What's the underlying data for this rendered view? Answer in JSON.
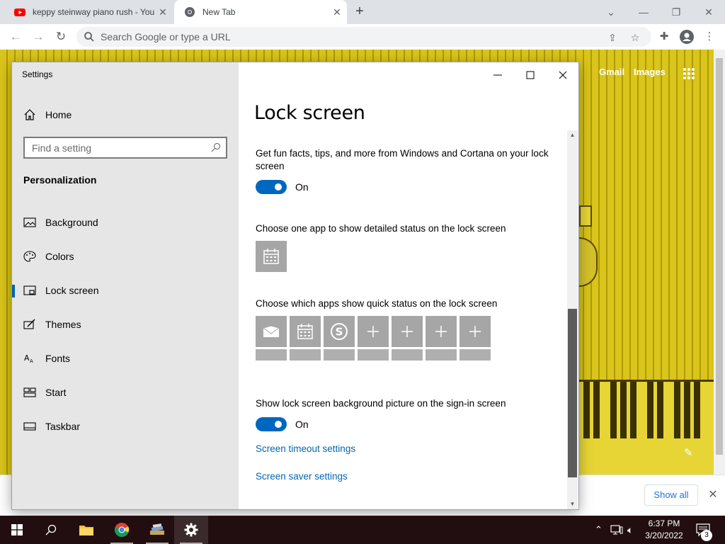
{
  "browser": {
    "tabs": [
      {
        "label": "keppy steinway piano rush - You",
        "icon": "youtube-icon"
      },
      {
        "label": "New Tab",
        "icon": "chrome-icon"
      }
    ],
    "omnibox_placeholder": "Search Google or type a URL"
  },
  "ntp": {
    "gmail": "Gmail",
    "images": "Images",
    "show_all": "Show all"
  },
  "settings": {
    "window_title": "Settings",
    "home": "Home",
    "search_placeholder": "Find a setting",
    "group": "Personalization",
    "nav": [
      {
        "label": "Background",
        "icon": "picture-icon"
      },
      {
        "label": "Colors",
        "icon": "palette-icon"
      },
      {
        "label": "Lock screen",
        "icon": "lock-screen-icon"
      },
      {
        "label": "Themes",
        "icon": "brush-icon"
      },
      {
        "label": "Fonts",
        "icon": "font-icon"
      },
      {
        "label": "Start",
        "icon": "start-icon"
      },
      {
        "label": "Taskbar",
        "icon": "taskbar-icon"
      }
    ],
    "page_title": "Lock screen",
    "fun_facts_text": "Get fun facts, tips, and more from Windows and Cortana on your lock screen",
    "toggle1_state": "On",
    "detailed_status_text": "Choose one app to show detailed status on the lock screen",
    "quick_status_text": "Choose which apps show quick status on the lock screen",
    "quick_apps": [
      "mail-icon",
      "calendar-icon",
      "skype-icon",
      "plus-icon",
      "plus-icon",
      "plus-icon",
      "plus-icon"
    ],
    "signin_text": "Show lock screen background picture on the sign-in screen",
    "toggle2_state": "On",
    "link_timeout": "Screen timeout settings",
    "link_saver": "Screen saver settings"
  },
  "taskbar": {
    "time": "6:37 PM",
    "date": "3/20/2022",
    "notification_count": "3"
  },
  "colors": {
    "accent": "#0067c0",
    "link": "#0066b4",
    "taskbar": "#220e10",
    "doodle": "#d9c51b"
  }
}
